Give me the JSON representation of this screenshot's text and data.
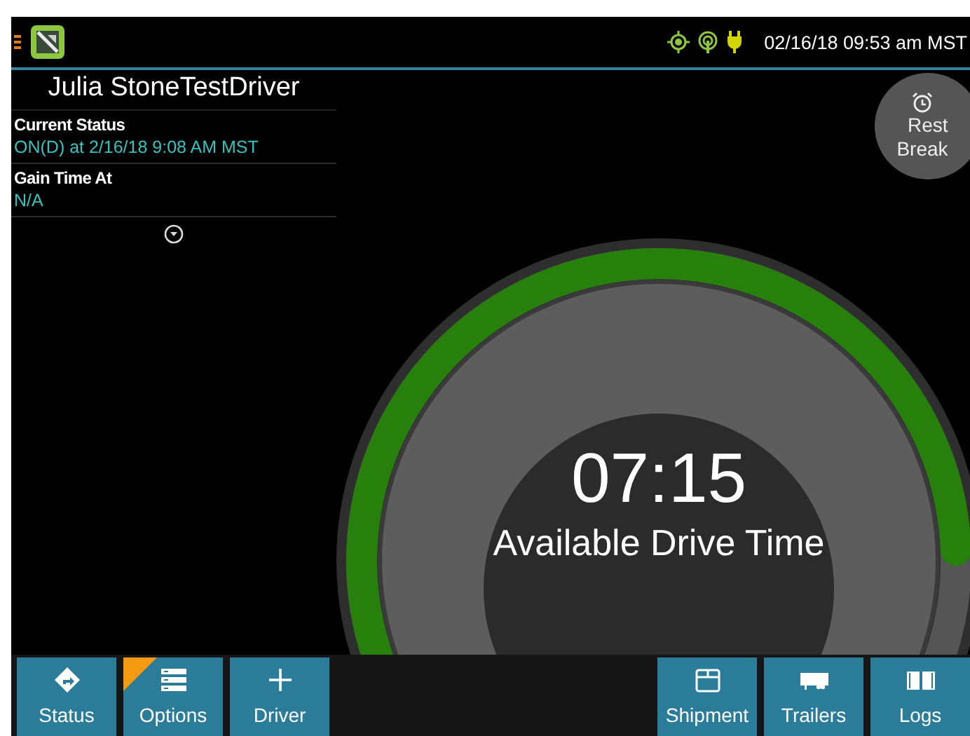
{
  "status_bar": {
    "datetime": "02/16/18 09:53 am MST"
  },
  "driver": {
    "name": "Julia StoneTestDriver"
  },
  "info": [
    {
      "label": "Current Status",
      "value": "ON(D) at 2/16/18 9:08 AM MST"
    },
    {
      "label": "Gain Time At",
      "value": "N/A"
    }
  ],
  "rest_break": {
    "line1": "Rest",
    "line2": "Break"
  },
  "gauge": {
    "time": "07:15",
    "label": "Available Drive Time"
  },
  "left_buttons": [
    {
      "label": "Status",
      "kind": "direction",
      "alert": false
    },
    {
      "label": "Options",
      "kind": "list",
      "alert": true
    },
    {
      "label": "Driver",
      "kind": "plus",
      "alert": false
    }
  ],
  "right_buttons": [
    {
      "label": "Shipment",
      "kind": "box",
      "alert": false
    },
    {
      "label": "Trailers",
      "kind": "trailer",
      "alert": false
    },
    {
      "label": "Logs",
      "kind": "book",
      "alert": false
    }
  ]
}
